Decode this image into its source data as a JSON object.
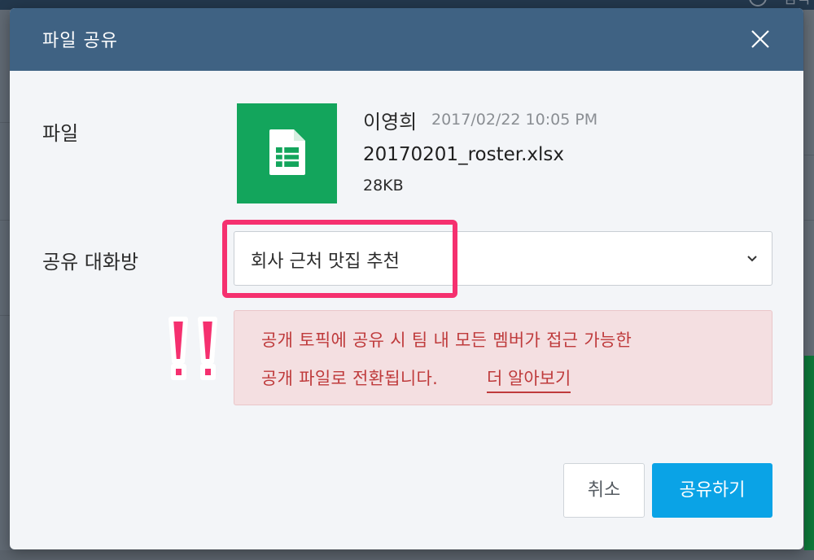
{
  "background": {
    "search_label": "검색"
  },
  "dialog": {
    "title": "파일 공유",
    "close_icon": "close-icon",
    "file_section": {
      "label": "파일",
      "icon": "spreadsheet-icon",
      "icon_color": "#13a55c",
      "owner": "이영희",
      "date": "2017/02/22 10:05 PM",
      "filename": "20170201_roster.xlsx",
      "size": "28KB"
    },
    "share_room": {
      "label": "공유 대화방",
      "selected_value": "회사 근처 맛집 추천",
      "chevron_icon": "chevron-down-icon",
      "highlight_color": "#f5306f"
    },
    "warning": {
      "line1": "공개 토픽에 공유 시 팀 내 모든 멤버가 접근 가능한",
      "line2": "공개 파일로 전환됩니다.",
      "link": "더 알아보기",
      "color": "#bf3b3c"
    },
    "buttons": {
      "cancel": "취소",
      "share": "공유하기",
      "share_color": "#0aa3e6"
    },
    "header_color": "#3f6283"
  }
}
